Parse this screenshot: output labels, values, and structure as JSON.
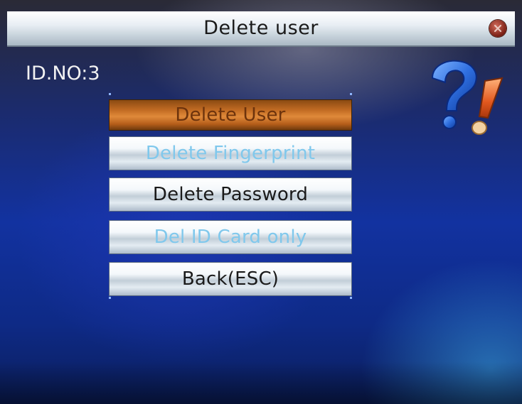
{
  "window": {
    "title": "Delete user"
  },
  "user": {
    "id_label": "ID.NO:3"
  },
  "menu": {
    "items": [
      {
        "label": "Delete User",
        "state": "selected"
      },
      {
        "label": "Delete Fingerprint",
        "state": "disabled"
      },
      {
        "label": "Delete Password",
        "state": "enabled"
      },
      {
        "label": "Del ID Card only",
        "state": "disabled"
      },
      {
        "label": "Back(ESC)",
        "state": "enabled"
      }
    ]
  },
  "icons": {
    "close": "close-icon",
    "help": "question-exclamation-icon"
  },
  "colors": {
    "selected_item": "#c46d24",
    "disabled_text": "#80c8ec",
    "enabled_text": "#1a1a1a",
    "background": "#1232a0"
  }
}
